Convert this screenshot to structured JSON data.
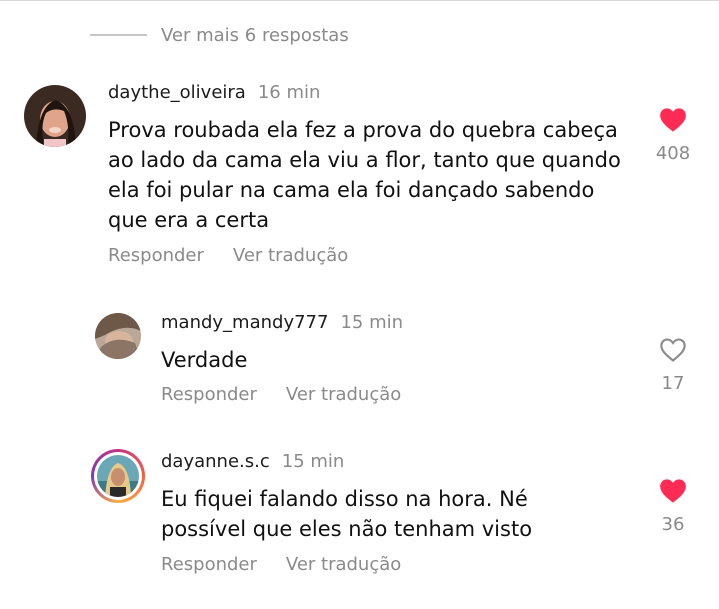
{
  "more_replies": "Ver mais 6 respostas",
  "actions": {
    "reply": "Responder",
    "translate": "Ver tradução"
  },
  "colors": {
    "liked": "#fe2c55",
    "muted": "#8a8a8a",
    "story_ring": "#c13584"
  },
  "comments": [
    {
      "username": "daythe_oliveira",
      "time": "16 min",
      "lines": [
        "Prova roubada ela fez a prova do quebra cabeça",
        "ao lado da cama ela viu a flor, tanto que quando",
        "ela foi pular na cama ela foi dançado sabendo",
        "que era a certa"
      ],
      "likes": "408",
      "liked": true
    },
    {
      "username": "mandy_mandy777",
      "time": "15 min",
      "lines": [
        "Verdade"
      ],
      "likes": "17",
      "liked": false
    },
    {
      "username": "dayanne.s.c",
      "time": "15 min",
      "lines": [
        "Eu fiquei falando disso na hora. Né",
        "possível que eles não tenham visto"
      ],
      "likes": "36",
      "liked": true
    }
  ]
}
